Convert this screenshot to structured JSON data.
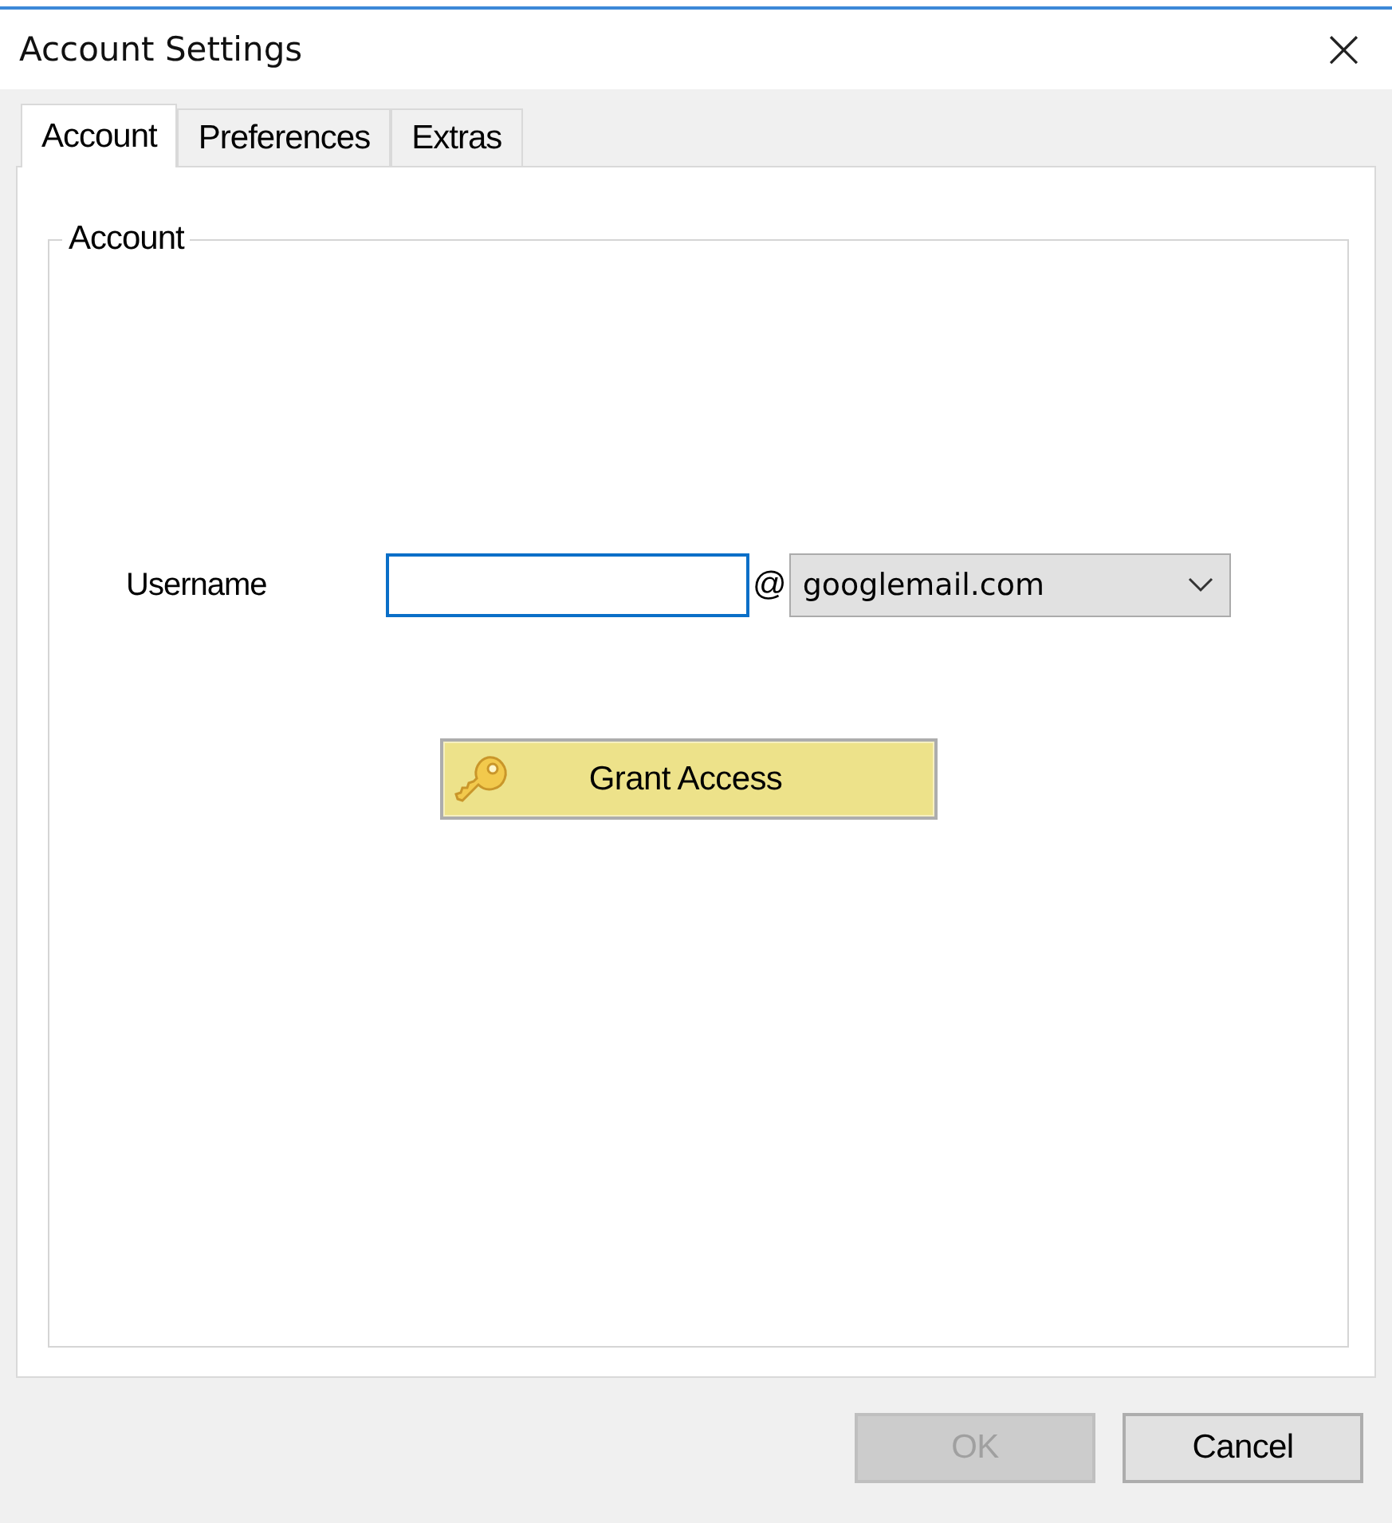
{
  "window": {
    "title": "Account Settings",
    "close": "×"
  },
  "tabs": [
    {
      "label": "Account",
      "selected": true
    },
    {
      "label": "Preferences",
      "selected": false
    },
    {
      "label": "Extras",
      "selected": false
    }
  ],
  "group": {
    "title": "Account"
  },
  "username": {
    "label": "Username",
    "focused": true
  },
  "at_sign": "@",
  "domain": {
    "value": "googlemail.com"
  },
  "grant_button": {
    "label": "Grant Access"
  },
  "buttons": [
    {
      "label": "OK",
      "disabled": true
    },
    {
      "label": "Cancel",
      "disabled": false
    }
  ]
}
